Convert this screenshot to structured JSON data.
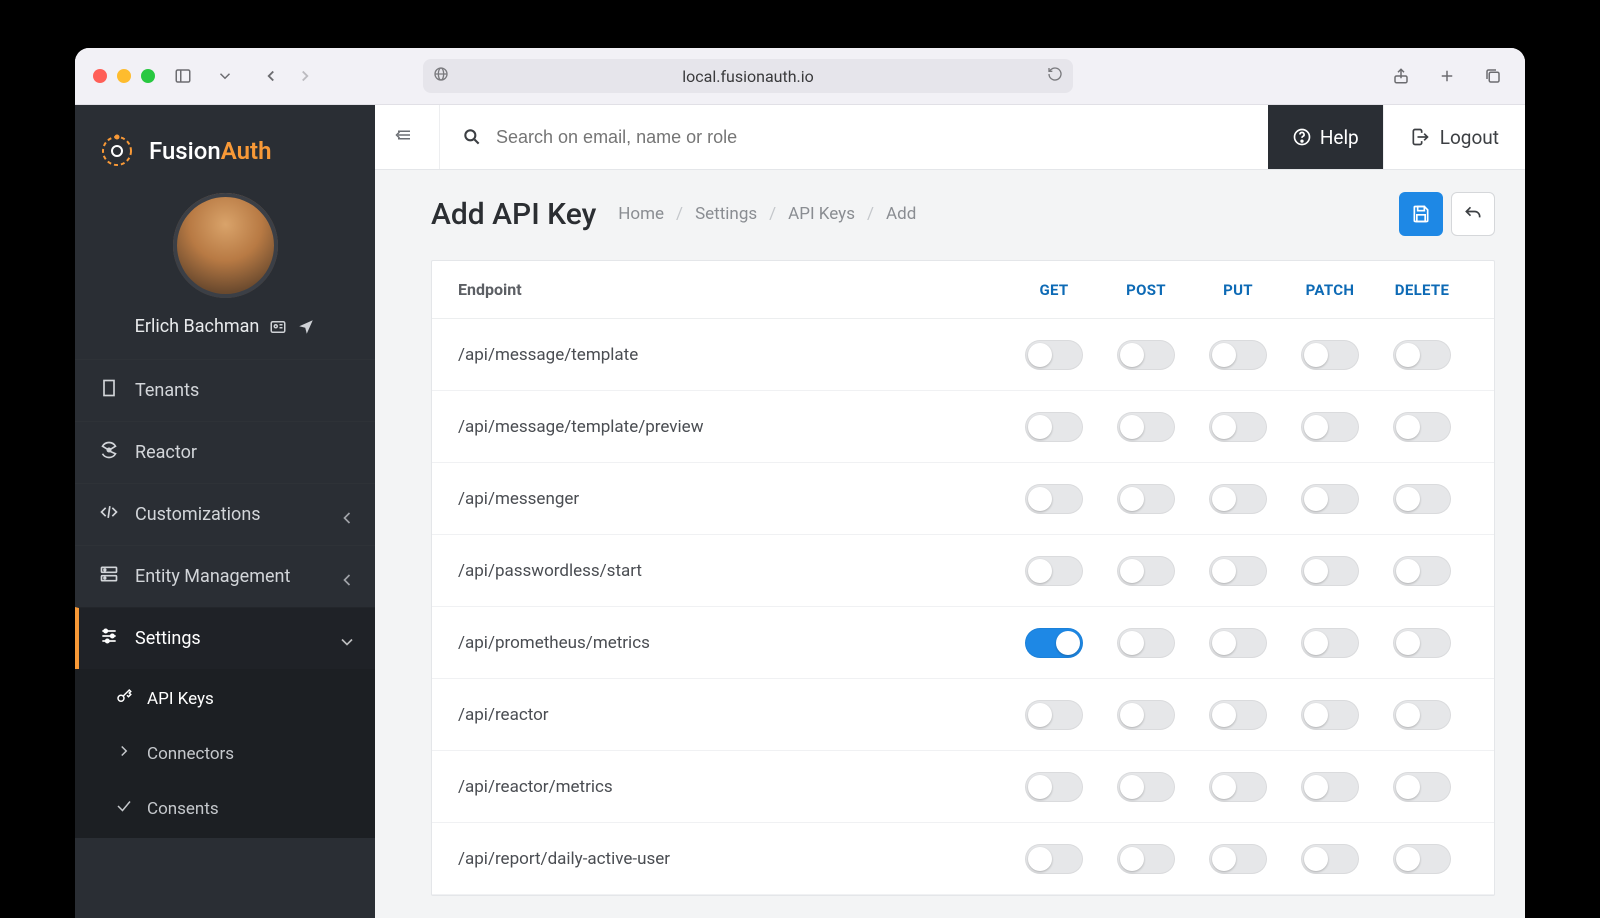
{
  "browser": {
    "url": "local.fusionauth.io"
  },
  "brand": {
    "name_prefix": "Fusion",
    "name_suffix": "Auth"
  },
  "user": {
    "name": "Erlich Bachman"
  },
  "sidebar": {
    "items": [
      {
        "label": "Tenants",
        "icon": "building"
      },
      {
        "label": "Reactor",
        "icon": "radiation"
      },
      {
        "label": "Customizations",
        "icon": "code",
        "expandable": true
      },
      {
        "label": "Entity Management",
        "icon": "servers",
        "expandable": true
      },
      {
        "label": "Settings",
        "icon": "sliders",
        "expandable": true,
        "active": true
      }
    ],
    "sub": [
      {
        "label": "API Keys",
        "icon": "key",
        "selected": true
      },
      {
        "label": "Connectors",
        "icon": "chevron-right"
      },
      {
        "label": "Consents",
        "icon": "check"
      }
    ]
  },
  "topbar": {
    "search_placeholder": "Search on email, name or role",
    "help": "Help",
    "logout": "Logout"
  },
  "page": {
    "title": "Add API Key",
    "crumbs": [
      "Home",
      "Settings",
      "API Keys",
      "Add"
    ]
  },
  "table": {
    "header_endpoint": "Endpoint",
    "methods": [
      "GET",
      "POST",
      "PUT",
      "PATCH",
      "DELETE"
    ],
    "rows": [
      {
        "endpoint": "/api/message/template",
        "toggles": [
          false,
          false,
          false,
          false,
          false
        ]
      },
      {
        "endpoint": "/api/message/template/preview",
        "toggles": [
          false,
          false,
          false,
          false,
          false
        ]
      },
      {
        "endpoint": "/api/messenger",
        "toggles": [
          false,
          false,
          false,
          false,
          false
        ]
      },
      {
        "endpoint": "/api/passwordless/start",
        "toggles": [
          false,
          false,
          false,
          false,
          false
        ]
      },
      {
        "endpoint": "/api/prometheus/metrics",
        "toggles": [
          true,
          false,
          false,
          false,
          false
        ]
      },
      {
        "endpoint": "/api/reactor",
        "toggles": [
          false,
          false,
          false,
          false,
          false
        ]
      },
      {
        "endpoint": "/api/reactor/metrics",
        "toggles": [
          false,
          false,
          false,
          false,
          false
        ]
      },
      {
        "endpoint": "/api/report/daily-active-user",
        "toggles": [
          false,
          false,
          false,
          false,
          false
        ]
      }
    ]
  }
}
